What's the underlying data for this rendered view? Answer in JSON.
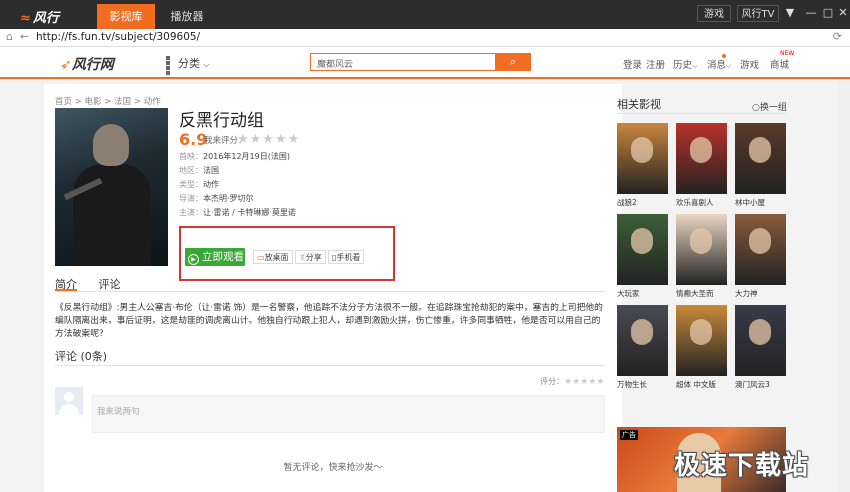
{
  "titlebar": {
    "logo": "风行",
    "tabs": [
      {
        "label": "影视库"
      },
      {
        "label": "播放器"
      }
    ],
    "game": "游戏",
    "tv": "风行TV",
    "menu": "▼",
    "minimize": "—",
    "maximize": "□",
    "close": "✕"
  },
  "address": {
    "url": "http://fs.fun.tv/subject/309605/"
  },
  "header": {
    "logo": "风行网",
    "category": "分类",
    "search_value": "魔都风云",
    "links": {
      "login": "登录",
      "register": "注册",
      "history": "历史",
      "messages": "消息",
      "game": "游戏",
      "mall": "商城",
      "hot": "NEW"
    }
  },
  "breadcrumb": "首页 > 电影 > 法国 > 动作",
  "movie": {
    "title": "反黑行动组",
    "score": "6.9",
    "rate_label": "我来评分：",
    "meta": [
      {
        "label": "首映：",
        "value": "2016年12月19日(法国)"
      },
      {
        "label": "地区：",
        "value": "法国"
      },
      {
        "label": "类型：",
        "value": "动作"
      },
      {
        "label": "导演：",
        "value": "本杰明·罗切尔"
      },
      {
        "label": "主演：",
        "value": "让·雷诺 / 卡特琳娜·莫里诺"
      }
    ],
    "watch": "立即观看",
    "actions": {
      "desktop": "放桌面",
      "share": "分享",
      "mobile": "手机看"
    }
  },
  "tabs": {
    "intro": "简介",
    "comments": "评论"
  },
  "description": "《反黑行动组》:男主人公塞吉·布伦（让·雷诺 饰）是一名警察，他追踪不法分子方法很不一般。在追踪珠宝抢劫犯的案中，塞吉的上司把他的编队隔离出来，事后证明，这是劫匪的调虎离山计。他独自行动跟上犯人，却遇到激励火拼，伤亡惨重，许多同事牺牲，他是否可以用自己的方法破案呢？",
  "comments": {
    "title": "评论 (0条)",
    "rate_label": "评分：",
    "placeholder": "我来说两句",
    "empty": "暂无评论，快来抢沙发～"
  },
  "related": {
    "title": "相关影视",
    "swap": "换一组",
    "items": [
      {
        "label": "战狼2",
        "color": "#c9873f"
      },
      {
        "label": "欢乐喜剧人",
        "color": "#b8322a"
      },
      {
        "label": "林中小屋",
        "color": "#5a3a2a"
      },
      {
        "label": "大玩家",
        "color": "#3e5e3a"
      },
      {
        "label": "情癫大圣而",
        "color": "#e9d6c4"
      },
      {
        "label": "大力神",
        "color": "#8a5b3c"
      },
      {
        "label": "万物生长",
        "color": "#4a4a52"
      },
      {
        "label": "超体 中文版",
        "color": "#c98a3a"
      },
      {
        "label": "澳门风云3",
        "color": "#3a3a4a"
      }
    ]
  },
  "ad": {
    "badge": "广告",
    "watermark": "极速下载站"
  }
}
